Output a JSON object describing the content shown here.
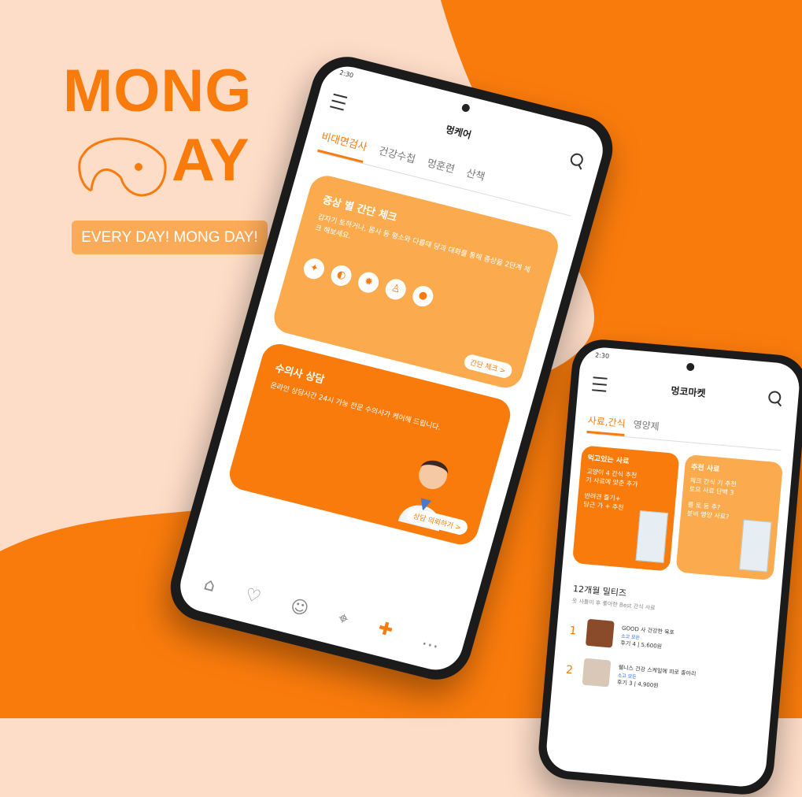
{
  "brand": {
    "line1": "MONG",
    "line2": "AY",
    "slogan": "EVERY DAY! MONG DAY!",
    "accent": "#f97b0c",
    "bg": "#fddcc8"
  },
  "phone1": {
    "time": "2:30",
    "title": "멍케어",
    "tabs": [
      "비대면검사",
      "건강수첩",
      "멍훈련",
      "산책"
    ],
    "card1": {
      "title": "증상 별 간단 체크",
      "desc": "갑자기 토하거나, 몸사 등 평소와 다를때\n당과 대화를 통해 증상을 2단계 체크 해보세요.",
      "cta": "간단 체크 >"
    },
    "card1_icons": [
      "pill-icon",
      "capsule-icon",
      "virus-icon",
      "tooth-icon",
      "poop-icon"
    ],
    "card2": {
      "title": "수의사 상담",
      "desc": "온라인 상담시간 24시 가능\n전문 수의사가 케어해 드립니다.",
      "cta": "상담 의뢰하기 >"
    },
    "nav": [
      "home-icon",
      "heart-icon",
      "dog-icon",
      "map-icon",
      "bone-icon",
      "chat-icon"
    ]
  },
  "phone2": {
    "time": "2:30",
    "title": "멍코마켓",
    "tabs": [
      "사료,간식",
      "영양제"
    ],
    "card_left": {
      "title": "먹고있는 사료",
      "desc": "고양이 4 간식 추천\n기 사료에 맞춘 추가\n\n반려견 즐기+\n당근 가 + 추천",
      "color": "#f97b0c"
    },
    "card_right": {
      "title": "추천 사료",
      "desc": "체크 간식 기 추천\n토요 사료 단백 3\n\n를 토 등 추?\n분비 영양 사료?",
      "color": "#fbab4e"
    },
    "ranking_title": "12개월 밀티즈",
    "ranking_sub": "옷 사들이 후 좋아한 Best 간식 사료",
    "items": [
      {
        "rank": "1",
        "name": "GOOD 사 건강한 육포",
        "tag": "소고 모든",
        "meta": "후기 4 | 5,600원"
      },
      {
        "rank": "2",
        "name": "웰니스 건강 스케일에 피로 종아리",
        "tag": "소고 모든",
        "meta": "후기 3 | 4,900원"
      }
    ]
  }
}
